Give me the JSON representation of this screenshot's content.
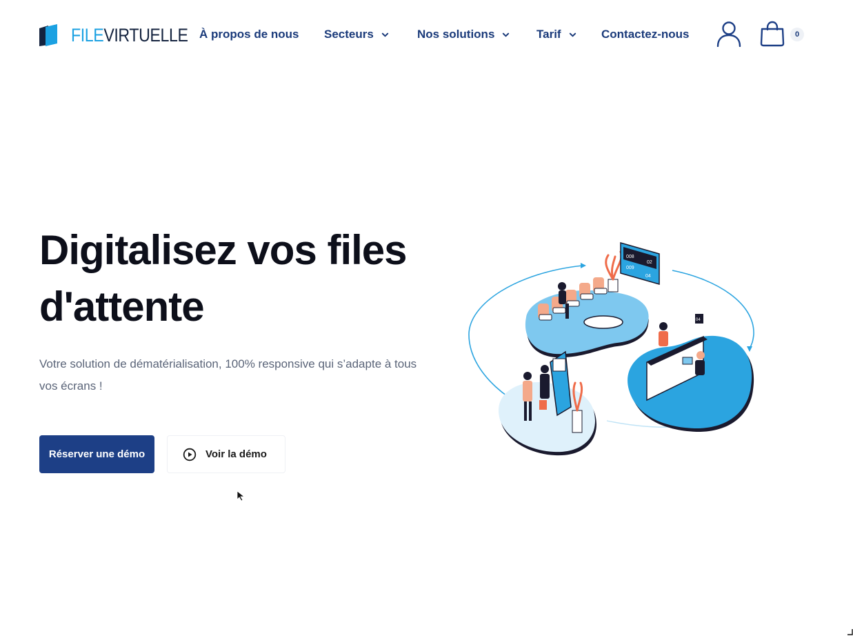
{
  "header": {
    "logo": {
      "part1": "FILE",
      "part2": "VIRTUELLE"
    },
    "nav": [
      {
        "label": "À propos de nous",
        "has_dropdown": false
      },
      {
        "label": "Secteurs",
        "has_dropdown": true
      },
      {
        "label": "Nos solutions",
        "has_dropdown": true
      },
      {
        "label": "Tarif",
        "has_dropdown": true
      },
      {
        "label": "Contactez-nous",
        "has_dropdown": false
      }
    ],
    "user_icon": "user-icon",
    "cart_icon": "shopping-bag-icon",
    "cart_count": "0"
  },
  "hero": {
    "title": "Digitalisez vos files d'attente",
    "subtitle": "Votre solution de dématérialisation, 100% responsive qui s’adapte à tous vos écrans !",
    "primary_button": "Réserver une démo",
    "secondary_button": "Voir la démo",
    "secondary_icon": "play-circle-icon"
  },
  "illustration": {
    "board": {
      "row1": [
        "008",
        "02"
      ],
      "row2": [
        "009",
        "04"
      ]
    },
    "counter_sign": "04"
  },
  "colors": {
    "brand_navy": "#1d3f86",
    "nav_text": "#1a3a7a",
    "accent_blue": "#1ba1e2",
    "title": "#0d0f1a",
    "subtitle": "#5a6478"
  }
}
